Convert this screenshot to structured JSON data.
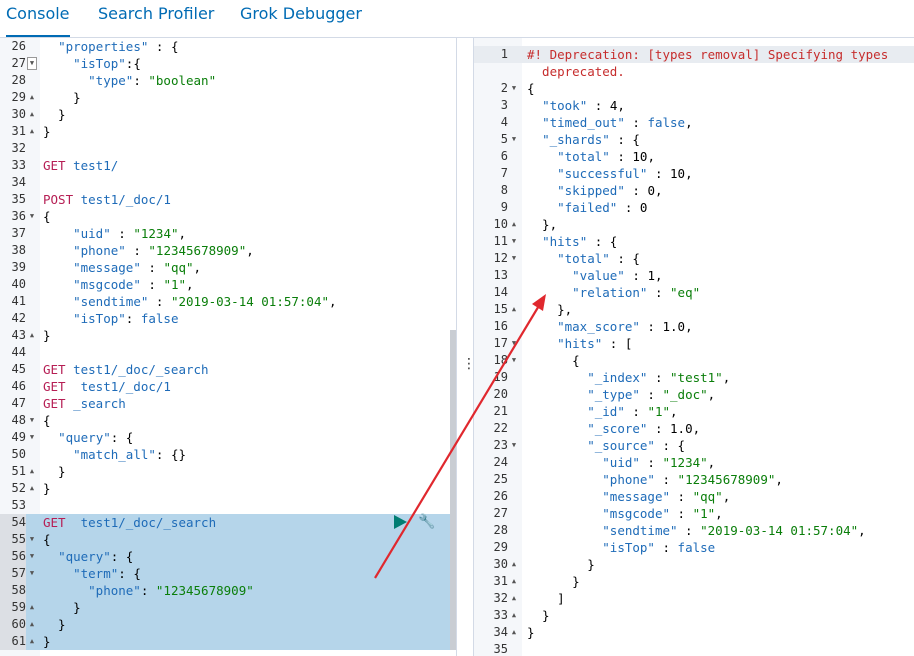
{
  "tabs": [
    {
      "label": "Console",
      "active": true
    },
    {
      "label": "Search Profiler",
      "active": false
    },
    {
      "label": "Grok Debugger",
      "active": false
    }
  ],
  "editor": {
    "lines": [
      {
        "n": "26",
        "fold": "",
        "t": "  \"properties\" : {"
      },
      {
        "n": "27",
        "fold": "box",
        "t": "    \"isTop\":{"
      },
      {
        "n": "28",
        "fold": "",
        "t": "      \"type\": \"boolean\""
      },
      {
        "n": "29",
        "fold": "up",
        "t": "    }"
      },
      {
        "n": "30",
        "fold": "up",
        "t": "  }"
      },
      {
        "n": "31",
        "fold": "up",
        "t": "}"
      },
      {
        "n": "32",
        "fold": "",
        "t": ""
      },
      {
        "n": "33",
        "fold": "",
        "t": "GET test1/"
      },
      {
        "n": "34",
        "fold": "",
        "t": ""
      },
      {
        "n": "35",
        "fold": "",
        "t": "POST test1/_doc/1"
      },
      {
        "n": "36",
        "fold": "down",
        "t": "{"
      },
      {
        "n": "37",
        "fold": "",
        "t": "    \"uid\" : \"1234\","
      },
      {
        "n": "38",
        "fold": "",
        "t": "    \"phone\" : \"12345678909\","
      },
      {
        "n": "39",
        "fold": "",
        "t": "    \"message\" : \"qq\","
      },
      {
        "n": "40",
        "fold": "",
        "t": "    \"msgcode\" : \"1\","
      },
      {
        "n": "41",
        "fold": "",
        "t": "    \"sendtime\" : \"2019-03-14 01:57:04\","
      },
      {
        "n": "42",
        "fold": "",
        "t": "    \"isTop\": false"
      },
      {
        "n": "43",
        "fold": "up",
        "t": "}"
      },
      {
        "n": "44",
        "fold": "",
        "t": ""
      },
      {
        "n": "45",
        "fold": "",
        "t": "GET test1/_doc/_search"
      },
      {
        "n": "46",
        "fold": "",
        "t": "GET  test1/_doc/1"
      },
      {
        "n": "47",
        "fold": "",
        "t": "GET _search"
      },
      {
        "n": "48",
        "fold": "down",
        "t": "{"
      },
      {
        "n": "49",
        "fold": "down",
        "t": "  \"query\": {"
      },
      {
        "n": "50",
        "fold": "",
        "t": "    \"match_all\": {}"
      },
      {
        "n": "51",
        "fold": "up",
        "t": "  }"
      },
      {
        "n": "52",
        "fold": "up",
        "t": "}"
      },
      {
        "n": "53",
        "fold": "",
        "t": ""
      },
      {
        "n": "54",
        "fold": "",
        "t": "GET  test1/_doc/_search"
      },
      {
        "n": "55",
        "fold": "down",
        "t": "{"
      },
      {
        "n": "56",
        "fold": "down",
        "t": "  \"query\": {"
      },
      {
        "n": "57",
        "fold": "down",
        "t": "    \"term\": {"
      },
      {
        "n": "58",
        "fold": "",
        "t": "      \"phone\": \"12345678909\""
      },
      {
        "n": "59",
        "fold": "up",
        "t": "    }"
      },
      {
        "n": "60",
        "fold": "up",
        "t": "  }"
      },
      {
        "n": "61",
        "fold": "up",
        "t": "}"
      }
    ]
  },
  "output": {
    "lines": [
      {
        "n": "1",
        "fold": "",
        "t": "#! Deprecation: [types removal] Specifying types"
      },
      {
        "n": "",
        "fold": "",
        "t": "  deprecated."
      },
      {
        "n": "2",
        "fold": "down",
        "t": "{"
      },
      {
        "n": "3",
        "fold": "",
        "t": "  \"took\" : 4,"
      },
      {
        "n": "4",
        "fold": "",
        "t": "  \"timed_out\" : false,"
      },
      {
        "n": "5",
        "fold": "down",
        "t": "  \"_shards\" : {"
      },
      {
        "n": "6",
        "fold": "",
        "t": "    \"total\" : 10,"
      },
      {
        "n": "7",
        "fold": "",
        "t": "    \"successful\" : 10,"
      },
      {
        "n": "8",
        "fold": "",
        "t": "    \"skipped\" : 0,"
      },
      {
        "n": "9",
        "fold": "",
        "t": "    \"failed\" : 0"
      },
      {
        "n": "10",
        "fold": "up",
        "t": "  },"
      },
      {
        "n": "11",
        "fold": "down",
        "t": "  \"hits\" : {"
      },
      {
        "n": "12",
        "fold": "down",
        "t": "    \"total\" : {"
      },
      {
        "n": "13",
        "fold": "",
        "t": "      \"value\" : 1,"
      },
      {
        "n": "14",
        "fold": "",
        "t": "      \"relation\" : \"eq\""
      },
      {
        "n": "15",
        "fold": "up",
        "t": "    },"
      },
      {
        "n": "16",
        "fold": "",
        "t": "    \"max_score\" : 1.0,"
      },
      {
        "n": "17",
        "fold": "down",
        "t": "    \"hits\" : ["
      },
      {
        "n": "18",
        "fold": "down",
        "t": "      {"
      },
      {
        "n": "19",
        "fold": "",
        "t": "        \"_index\" : \"test1\","
      },
      {
        "n": "20",
        "fold": "",
        "t": "        \"_type\" : \"_doc\","
      },
      {
        "n": "21",
        "fold": "",
        "t": "        \"_id\" : \"1\","
      },
      {
        "n": "22",
        "fold": "",
        "t": "        \"_score\" : 1.0,"
      },
      {
        "n": "23",
        "fold": "down",
        "t": "        \"_source\" : {"
      },
      {
        "n": "24",
        "fold": "",
        "t": "          \"uid\" : \"1234\","
      },
      {
        "n": "25",
        "fold": "",
        "t": "          \"phone\" : \"12345678909\","
      },
      {
        "n": "26",
        "fold": "",
        "t": "          \"message\" : \"qq\","
      },
      {
        "n": "27",
        "fold": "",
        "t": "          \"msgcode\" : \"1\","
      },
      {
        "n": "28",
        "fold": "",
        "t": "          \"sendtime\" : \"2019-03-14 01:57:04\","
      },
      {
        "n": "29",
        "fold": "",
        "t": "          \"isTop\" : false"
      },
      {
        "n": "30",
        "fold": "up",
        "t": "        }"
      },
      {
        "n": "31",
        "fold": "up",
        "t": "      }"
      },
      {
        "n": "32",
        "fold": "up",
        "t": "    ]"
      },
      {
        "n": "33",
        "fold": "up",
        "t": "  }"
      },
      {
        "n": "34",
        "fold": "up",
        "t": "}"
      },
      {
        "n": "35",
        "fold": "",
        "t": ""
      }
    ]
  },
  "colors": {
    "accent": "#006bb4",
    "keyword": "#b61e54",
    "string": "#0a7e0a",
    "property": "#1e6bb8",
    "selection": "#b5d5ea",
    "annotation_arrow": "#e0282e"
  },
  "icons": {
    "run": "play-triangle-icon",
    "settings": "wrench-icon"
  }
}
